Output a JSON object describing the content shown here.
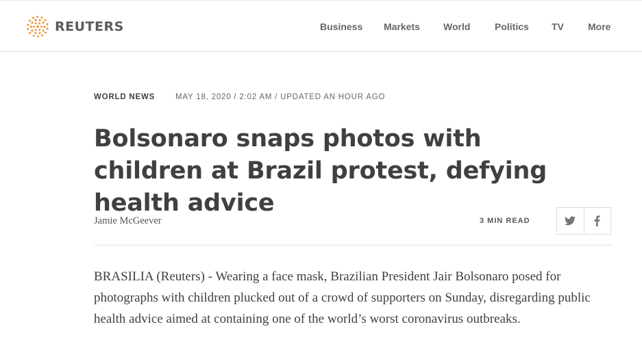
{
  "header": {
    "logo_text": "REUTERS",
    "logo_color": "#f28c22",
    "nav": [
      "Business",
      "Markets",
      "World",
      "Politics",
      "TV",
      "More"
    ]
  },
  "article": {
    "section": "WORLD NEWS",
    "date": "MAY 18, 2020 / 2:02 AM / UPDATED AN HOUR AGO",
    "headline": "Bolsonaro snaps photos with children at Brazil protest, defying health advice",
    "author": "Jamie McGeever",
    "read_time": "3 MIN READ",
    "share_icons": [
      "twitter-icon",
      "facebook-icon"
    ],
    "body": "BRASILIA (Reuters) - Wearing a face mask, Brazilian President Jair Bolsonaro posed for photographs with children plucked out of a crowd of supporters on Sunday, disregarding public health advice aimed at containing one of the world’s worst coronavirus outbreaks."
  }
}
